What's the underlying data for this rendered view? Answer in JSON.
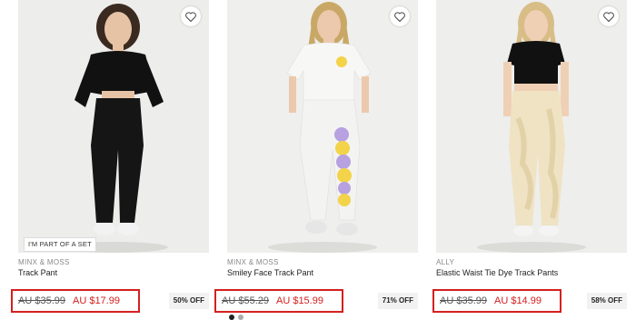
{
  "products": [
    {
      "brand": "MINX & MOSS",
      "name": "Track Pant",
      "old_price": "AU $35.99",
      "new_price": "AU $17.99",
      "discount": "50% OFF",
      "badge": "I'M PART OF A SET",
      "bg": "#ededeb",
      "top_color": "#111111",
      "pant_color": "#151515"
    },
    {
      "brand": "MINX & MOSS",
      "name": "Smiley Face Track Pant",
      "old_price": "AU $55.29",
      "new_price": "AU $15.99",
      "discount": "71% OFF",
      "bg": "#efefed",
      "top_color": "#f7f7f5",
      "pant_color": "#f3f3f1"
    },
    {
      "brand": "ALLY",
      "name": "Elastic Waist Tie Dye Track Pants",
      "old_price": "AU $35.99",
      "new_price": "AU $14.99",
      "discount": "58% OFF",
      "bg": "#eeeeec",
      "top_color": "#111111",
      "pant_color": "#efe3c4"
    }
  ],
  "accent_color": "#d42020"
}
